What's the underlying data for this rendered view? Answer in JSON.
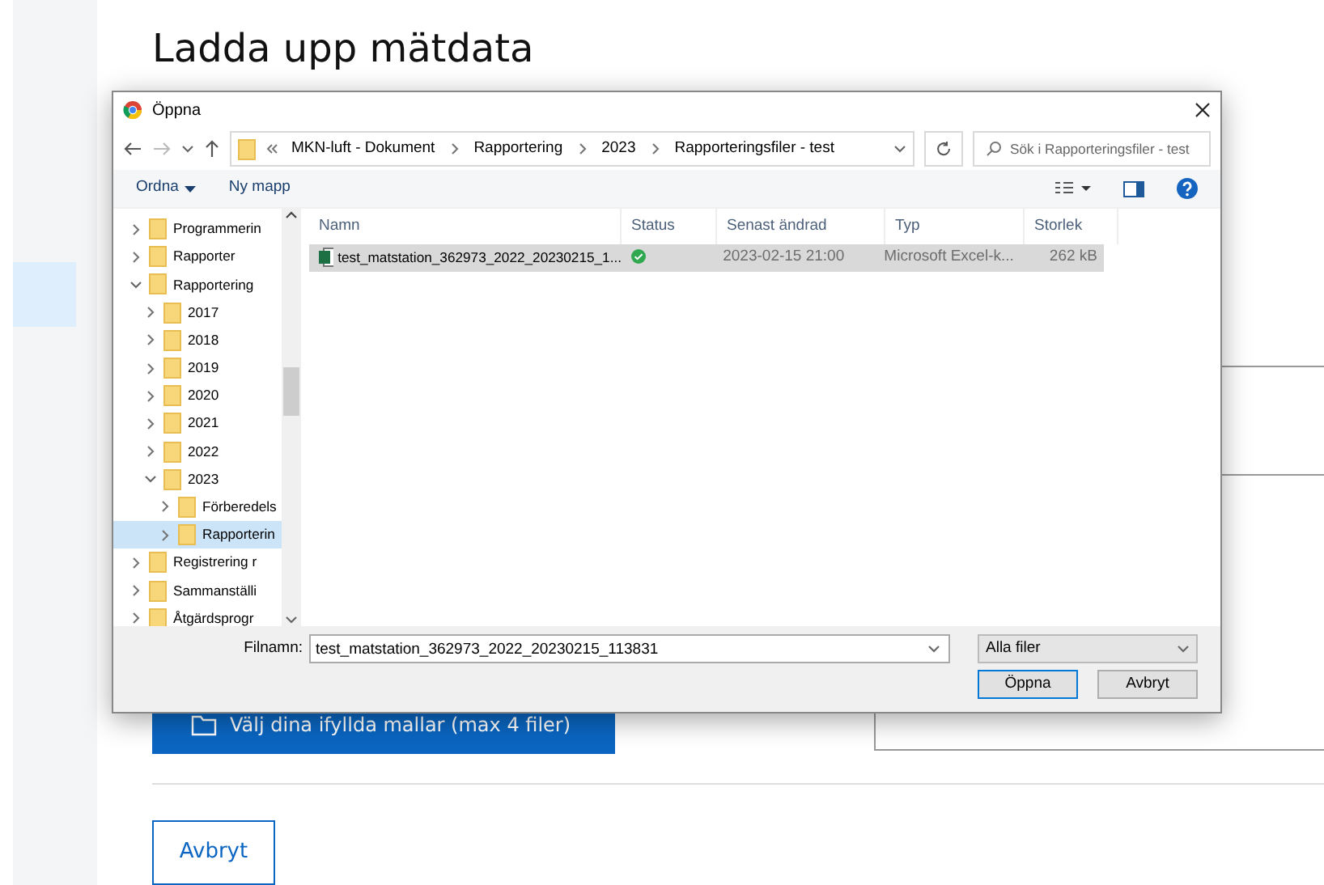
{
  "page": {
    "heading": "Ladda upp mätdata",
    "upload_button": "Välj dina ifyllda mallar (max 4 filer)",
    "cancel_button": "Avbryt"
  },
  "dialog": {
    "title": "Öppna",
    "breadcrumb": [
      "MKN-luft - Dokument",
      "Rapportering",
      "2023",
      "Rapporteringsfiler - test"
    ],
    "search": {
      "placeholder": "Sök i Rapporteringsfiler - test"
    },
    "toolbar": [
      "Ordna",
      "Ny mapp"
    ],
    "tree": [
      {
        "label": "Programmerin",
        "expanded": false,
        "selected": false
      },
      {
        "label": "Rapporter",
        "expanded": false,
        "selected": false
      },
      {
        "label": "Rapportering",
        "expanded": true,
        "selected": false,
        "children": [
          {
            "label": "2017",
            "expanded": false,
            "selected": false
          },
          {
            "label": "2018",
            "expanded": false,
            "selected": false
          },
          {
            "label": "2019",
            "expanded": false,
            "selected": false
          },
          {
            "label": "2020",
            "expanded": false,
            "selected": false
          },
          {
            "label": "2021",
            "expanded": false,
            "selected": false
          },
          {
            "label": "2022",
            "expanded": false,
            "selected": false
          },
          {
            "label": "2023",
            "expanded": true,
            "selected": false,
            "children": [
              {
                "label": "Förberedels",
                "expanded": false,
                "selected": false
              },
              {
                "label": "Rapporterin",
                "expanded": false,
                "selected": true
              }
            ]
          }
        ]
      },
      {
        "label": "Registrering r",
        "expanded": false,
        "selected": false
      },
      {
        "label": "Sammanställi",
        "expanded": false,
        "selected": false
      },
      {
        "label": "Åtgärdsprogr",
        "expanded": false,
        "selected": false
      }
    ],
    "columns": [
      "Namn",
      "Status",
      "Senast ändrad",
      "Typ",
      "Storlek"
    ],
    "files": [
      {
        "name": "test_matstation_362973_2022_20230215_1...",
        "date": "2023-02-15 21:00",
        "type": "Microsoft Excel-k...",
        "size": "262 kB",
        "selected": true
      }
    ],
    "filename_label": "Filnamn:",
    "filename": "test_matstation_362973_2022_20230215_113831",
    "filter": "Alla filer",
    "buttons": [
      "Öppna",
      "Avbryt"
    ]
  }
}
